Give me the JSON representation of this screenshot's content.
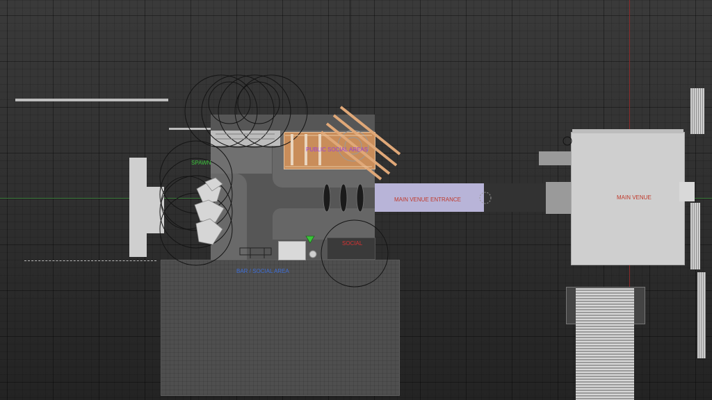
{
  "viewport": {
    "labels": {
      "spawn": "SPAWN",
      "public_social_areas": "PUBLIC SOCIAL AREAS",
      "main_venue_entrance": "MAIN VENUE ENTRANCE",
      "main_venue": "MAIN VENUE",
      "social": "SOCIAL",
      "bar_social_area": "BAR / SOCIAL AREA"
    },
    "colors": {
      "spawn": "#3bc43b",
      "public_social_areas": "#9a3fd8",
      "main_venue_entrance": "#c0392b",
      "main_venue": "#c0392b",
      "social": "#d83232",
      "bar_social_area": "#3f6fd8",
      "entrance_block": "#b8b4d8",
      "wood_pergola": "#d89a64",
      "x_axis": "#3f7f3f",
      "y_axis": "#8a2a2a"
    }
  }
}
